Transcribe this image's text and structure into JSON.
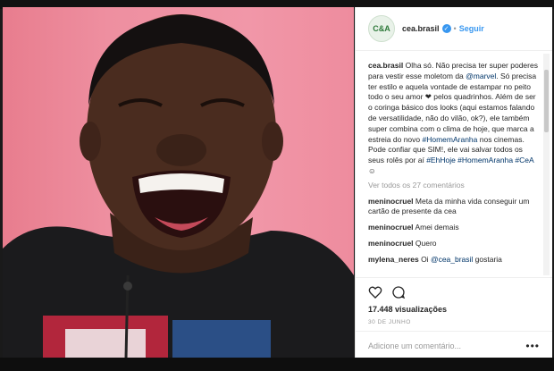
{
  "header": {
    "avatar_text": "C&A",
    "username": "cea.brasil",
    "separator": "•",
    "follow_label": "Seguir"
  },
  "caption": {
    "username": "cea.brasil",
    "text_1": " Olha só. Não precisa ter super poderes para vestir esse moletom da ",
    "mention": "@marvel",
    "text_2": ". Só precisa ter estilo e aquela vontade de estampar no peito todo o seu amor ",
    "heart": "❤",
    "text_3": " pelos quadrinhos. Além de ser o coringa básico dos looks (aqui estamos falando de versatilidade, não do vilão, ok?), ele também super combina com o clima de hoje, que marca a estreia do novo ",
    "tags_1": "#HomemAranha",
    "text_4": " nos cinemas. Pode confiar que SIM!, ele vai salvar todos os seus rolês por aí ",
    "tags_2": "#EhHoje #HomemAranha #CeA",
    "emoji": "☺"
  },
  "view_all": "Ver todos os 27 comentários",
  "comments": [
    {
      "user": "meninocruel",
      "text": " Meta da minha vida conseguir um cartão de presente da cea"
    },
    {
      "user": "meninocruel",
      "text": " Amei demais"
    },
    {
      "user": "meninocruel",
      "text": " Quero"
    },
    {
      "user": "mylena_neres",
      "text": " Oi ",
      "mention": "@cea_brasil",
      "text_2": " gostaria"
    }
  ],
  "views": "17.448 visualizações",
  "date": "30 DE JUNHO",
  "add_comment_placeholder": "Adicione um comentário...",
  "more_label": "•••",
  "colors": {
    "accent": "#3897f0",
    "background_pink": "#ee8fa0",
    "hashtag": "#003569"
  }
}
